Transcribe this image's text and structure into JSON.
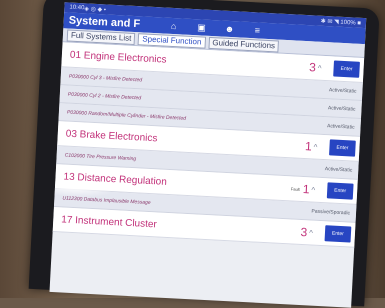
{
  "statusbar": {
    "time": "10:40",
    "icons": "◈ ◎ ◆ •",
    "right": "✱ ✉ ◥ 100% ■"
  },
  "appbar": {
    "title": "System and F"
  },
  "tabs": [
    {
      "label": "Full Systems List",
      "active": false
    },
    {
      "label": "Special Function",
      "active": true
    },
    {
      "label": "Guided Functions",
      "active": false
    }
  ],
  "systems": [
    {
      "name": "01 Engine Electronics",
      "status": "",
      "count": "3",
      "dtcs": [
        {
          "text": "P030000 Cyl 3 - Misfire Detected",
          "state": "Active/Static"
        },
        {
          "text": "P030000 Cyl 2 - Misfire Detected",
          "state": "Active/Static"
        },
        {
          "text": "P030000 Random/Multiple Cylinder - Misfire Detected",
          "state": "Active/Static"
        }
      ]
    },
    {
      "name": "03 Brake Electronics",
      "status": "",
      "count": "1",
      "dtcs": [
        {
          "text": "C102000 Tire Pressure Warning",
          "state": "Active/Static"
        }
      ]
    },
    {
      "name": "13 Distance Regulation",
      "status": "Fault",
      "count": "1",
      "dtcs": [
        {
          "text": "U112300 Databus Implausible Message",
          "state": "Passive/Sporadic"
        }
      ]
    },
    {
      "name": "17 Instrument Cluster",
      "status": "",
      "count": "3",
      "dtcs": []
    }
  ],
  "labels": {
    "enter": "Enter",
    "chevron": "^"
  }
}
